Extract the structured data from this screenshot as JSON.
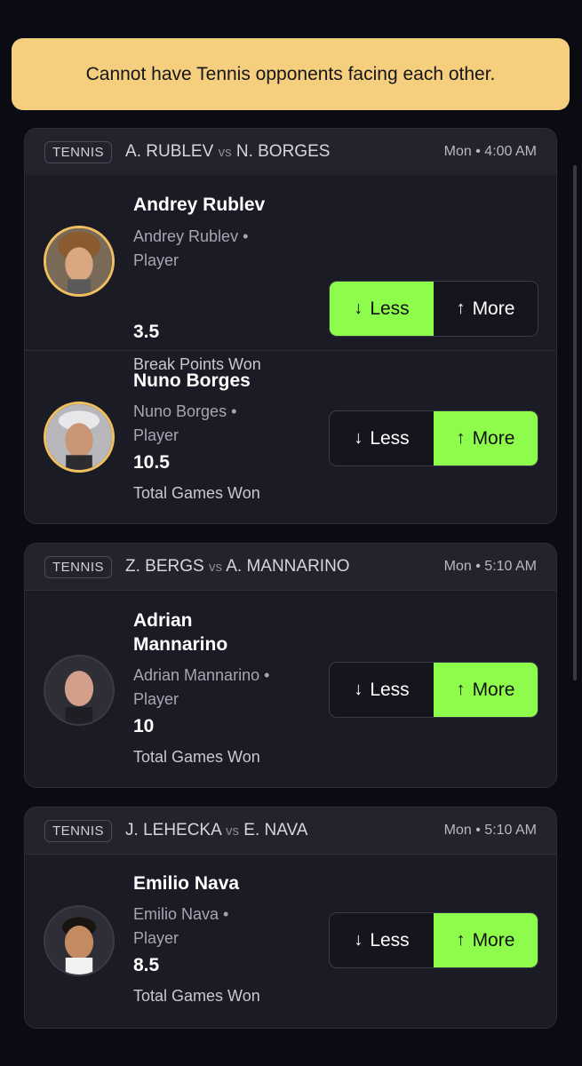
{
  "banner": {
    "text": "Cannot have Tennis opponents facing each other."
  },
  "cards": [
    {
      "sport": "TENNIS",
      "team_a": "A. RUBLEV",
      "vs": "vs",
      "team_b": "N. BORGES",
      "time": "Mon • 4:00 AM",
      "picks": [
        {
          "name": "Andrey Rublev",
          "sub1": "Andrey Rublev •",
          "sub2": "Player",
          "line": "3.5",
          "stat": "Break Points Won",
          "less": "Less",
          "more": "More",
          "selected": "less"
        },
        {
          "name": "Nuno Borges",
          "sub1": "Nuno Borges •",
          "sub2": "Player",
          "line": "10.5",
          "stat": "Total Games Won",
          "less": "Less",
          "more": "More",
          "selected": "more"
        }
      ]
    },
    {
      "sport": "TENNIS",
      "team_a": "Z. BERGS",
      "vs": "vs",
      "team_b": "A. MANNARINO",
      "time": "Mon • 5:10 AM",
      "picks": [
        {
          "name1": "Adrian",
          "name2": "Mannarino",
          "sub1": "Adrian Mannarino •",
          "sub2": "Player",
          "line": "10",
          "stat": "Total Games Won",
          "less": "Less",
          "more": "More",
          "selected": "more"
        }
      ]
    },
    {
      "sport": "TENNIS",
      "team_a": "J. LEHECKA",
      "vs": "vs",
      "team_b": "E. NAVA",
      "time": "Mon • 5:10 AM",
      "picks": [
        {
          "name": "Emilio Nava",
          "sub1": "Emilio Nava •",
          "sub2": "Player",
          "line": "8.5",
          "stat": "Total Games Won",
          "less": "Less",
          "more": "More",
          "selected": "more"
        }
      ]
    }
  ],
  "icons": {
    "less": "arrow-down-icon",
    "more": "arrow-up-icon"
  },
  "colors": {
    "accent": "#8efc4a",
    "banner": "#f5cf7d",
    "background": "#0b0b13",
    "card": "#1b1b25"
  }
}
